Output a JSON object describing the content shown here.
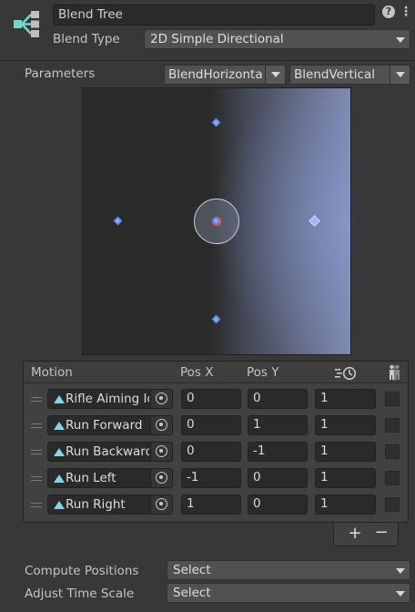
{
  "header": {
    "name": "Blend Tree",
    "blend_type_label": "Blend Type",
    "blend_type_value": "2D Simple Directional",
    "help_glyph": "?",
    "more_glyph": "⋮"
  },
  "parameters": {
    "label": "Parameters",
    "x_param": "BlendHorizontal",
    "y_param": "BlendVertical"
  },
  "graph": {
    "points": [
      {
        "x": 0,
        "y": 1
      },
      {
        "x": 0,
        "y": 0
      },
      {
        "x": 0,
        "y": -1
      },
      {
        "x": -1,
        "y": 0
      },
      {
        "x": 1,
        "y": 0
      }
    ],
    "cursor": {
      "x": 0,
      "y": 0
    },
    "highlight_color": "#7d88ad",
    "cursor_color": "#ff4f5a",
    "point_color": "#7fa6ff"
  },
  "motion_list": {
    "headers": {
      "motion": "Motion",
      "pos_x": "Pos X",
      "pos_y": "Pos Y",
      "speed_icon": "time-scale-icon",
      "mirror_icon": "mirror-icon"
    },
    "rows": [
      {
        "clip": "Rifle Aiming Idle",
        "pos_x": "0",
        "pos_y": "0",
        "speed": "1",
        "mirror": false
      },
      {
        "clip": "Run Forward",
        "pos_x": "0",
        "pos_y": "1",
        "speed": "1",
        "mirror": false
      },
      {
        "clip": "Run Backward",
        "pos_x": "0",
        "pos_y": "-1",
        "speed": "1",
        "mirror": false
      },
      {
        "clip": "Run Left",
        "pos_x": "-1",
        "pos_y": "0",
        "speed": "1",
        "mirror": false
      },
      {
        "clip": "Run Right",
        "pos_x": "1",
        "pos_y": "0",
        "speed": "1",
        "mirror": false
      }
    ],
    "add_glyph": "+",
    "remove_glyph": "−"
  },
  "footer": {
    "compute_positions_label": "Compute Positions",
    "compute_positions_value": "Select",
    "adjust_time_scale_label": "Adjust Time Scale",
    "adjust_time_scale_value": "Select"
  }
}
